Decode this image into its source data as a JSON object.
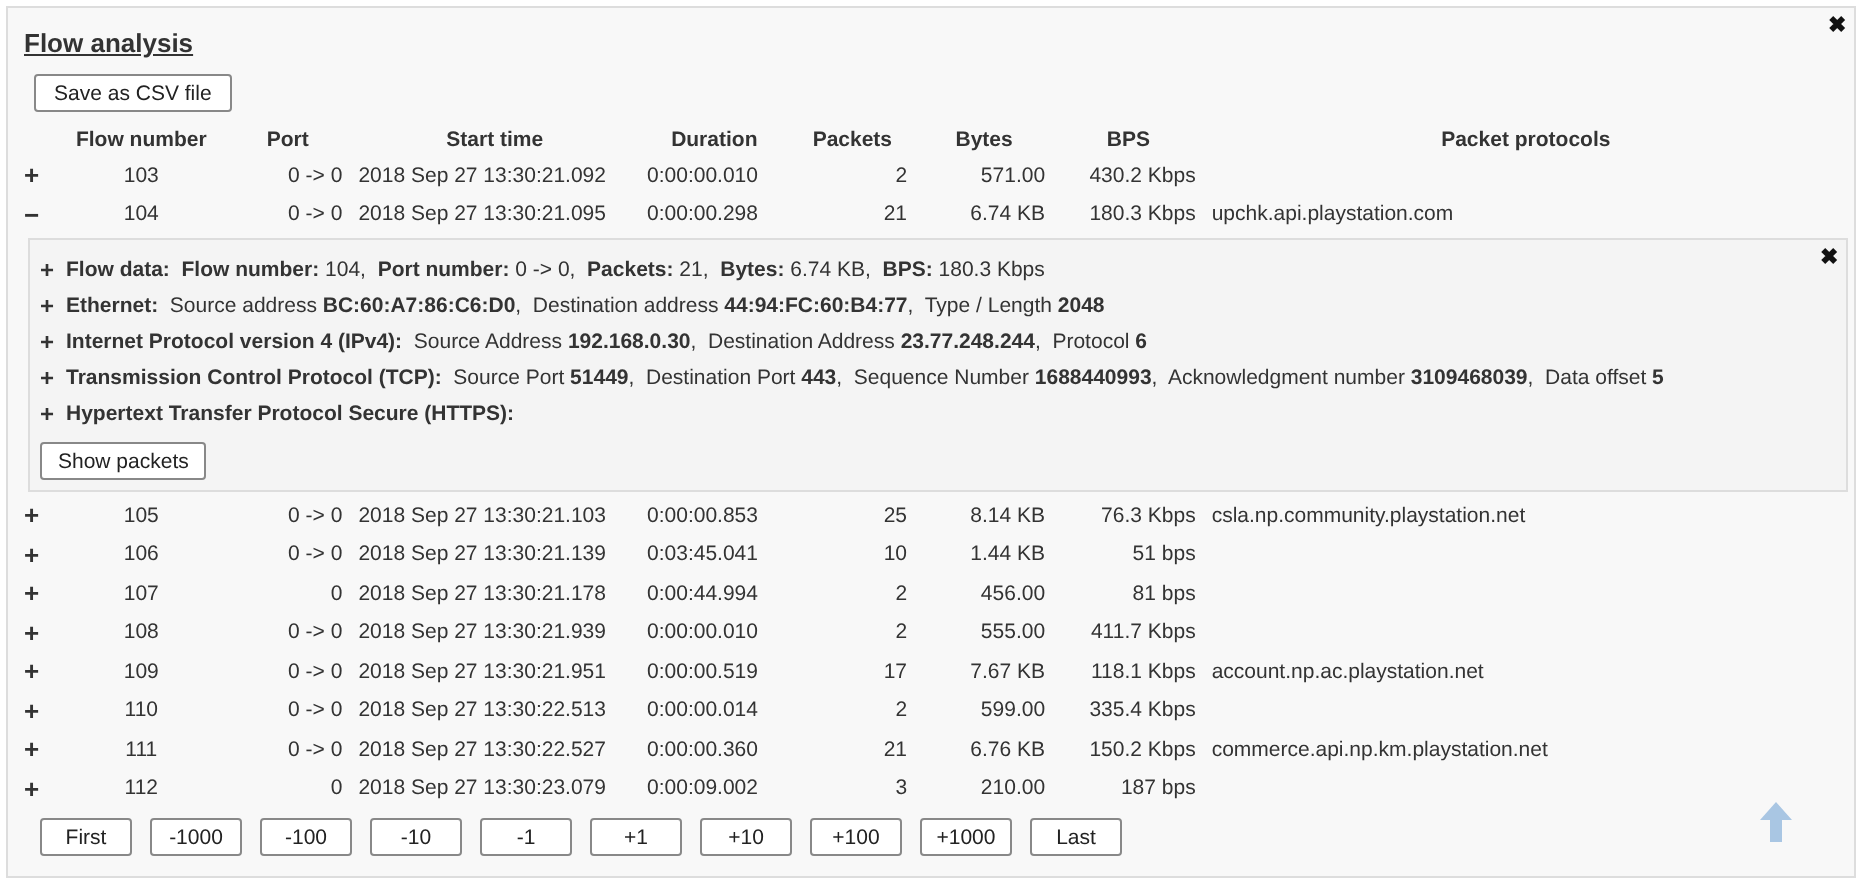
{
  "title": "Flow analysis",
  "close": "✖",
  "save_button": "Save as CSV file",
  "columns": [
    "Flow number",
    "Port",
    "Start time",
    "Duration",
    "Packets",
    "Bytes",
    "BPS",
    "Packet protocols"
  ],
  "rows": [
    {
      "toggle": "+",
      "expanded": false,
      "cells": [
        "103",
        "0 -> 0",
        "2018 Sep 27 13:30:21.092",
        "0:00:00.010",
        "2",
        "571.00",
        "430.2 Kbps",
        ""
      ]
    },
    {
      "toggle": "−",
      "expanded": true,
      "cells": [
        "104",
        "0 -> 0",
        "2018 Sep 27 13:30:21.095",
        "0:00:00.298",
        "21",
        "6.74 KB",
        "180.3 Kbps",
        "upchk.api.playstation.com"
      ],
      "details": {
        "close": "✖",
        "button": "Show packets",
        "lines": [
          {
            "toggle": "+",
            "text": "**Flow data:**  **Flow number:** 104,  **Port number:** 0 -> 0,  **Packets:** 21,  **Bytes:** 6.74 KB,  **BPS:** 180.3 Kbps"
          },
          {
            "toggle": "+",
            "text": "**Ethernet:**  Source address **BC:60:A7:86:C6:D0**,  Destination address **44:94:FC:60:B4:77**,  Type / Length **2048**"
          },
          {
            "toggle": "+",
            "text": "**Internet Protocol version 4 (IPv4):**  Source Address **192.168.0.30**,  Destination Address **23.77.248.244**,  Protocol **6**"
          },
          {
            "toggle": "+",
            "text": "**Transmission Control Protocol (TCP):**  Source Port **51449**,  Destination Port **443**,  Sequence Number **1688440993**,  Acknowledgment number **3109468039**,  Data offset **5**"
          },
          {
            "toggle": "+",
            "text": "**Hypertext Transfer Protocol Secure (HTTPS):**"
          }
        ]
      }
    },
    {
      "toggle": "+",
      "expanded": false,
      "cells": [
        "105",
        "0 -> 0",
        "2018 Sep 27 13:30:21.103",
        "0:00:00.853",
        "25",
        "8.14 KB",
        "76.3 Kbps",
        "csla.np.community.playstation.net"
      ]
    },
    {
      "toggle": "+",
      "expanded": false,
      "cells": [
        "106",
        "0 -> 0",
        "2018 Sep 27 13:30:21.139",
        "0:03:45.041",
        "10",
        "1.44 KB",
        "51 bps",
        ""
      ]
    },
    {
      "toggle": "+",
      "expanded": false,
      "cells": [
        "107",
        "0",
        "2018 Sep 27 13:30:21.178",
        "0:00:44.994",
        "2",
        "456.00",
        "81 bps",
        ""
      ]
    },
    {
      "toggle": "+",
      "expanded": false,
      "cells": [
        "108",
        "0 -> 0",
        "2018 Sep 27 13:30:21.939",
        "0:00:00.010",
        "2",
        "555.00",
        "411.7 Kbps",
        ""
      ]
    },
    {
      "toggle": "+",
      "expanded": false,
      "cells": [
        "109",
        "0 -> 0",
        "2018 Sep 27 13:30:21.951",
        "0:00:00.519",
        "17",
        "7.67 KB",
        "118.1 Kbps",
        "account.np.ac.playstation.net"
      ]
    },
    {
      "toggle": "+",
      "expanded": false,
      "cells": [
        "110",
        "0 -> 0",
        "2018 Sep 27 13:30:22.513",
        "0:00:00.014",
        "2",
        "599.00",
        "335.4 Kbps",
        ""
      ]
    },
    {
      "toggle": "+",
      "expanded": false,
      "cells": [
        "111",
        "0 -> 0",
        "2018 Sep 27 13:30:22.527",
        "0:00:00.360",
        "21",
        "6.76 KB",
        "150.2 Kbps",
        "commerce.api.np.km.playstation.net"
      ]
    },
    {
      "toggle": "+",
      "expanded": false,
      "cells": [
        "112",
        "0",
        "2018 Sep 27 13:30:23.079",
        "0:00:09.002",
        "3",
        "210.00",
        "187 bps",
        ""
      ]
    }
  ],
  "pager": [
    "First",
    "-1000",
    "-100",
    "-10",
    "-1",
    "+1",
    "+10",
    "+100",
    "+1000",
    "Last"
  ]
}
